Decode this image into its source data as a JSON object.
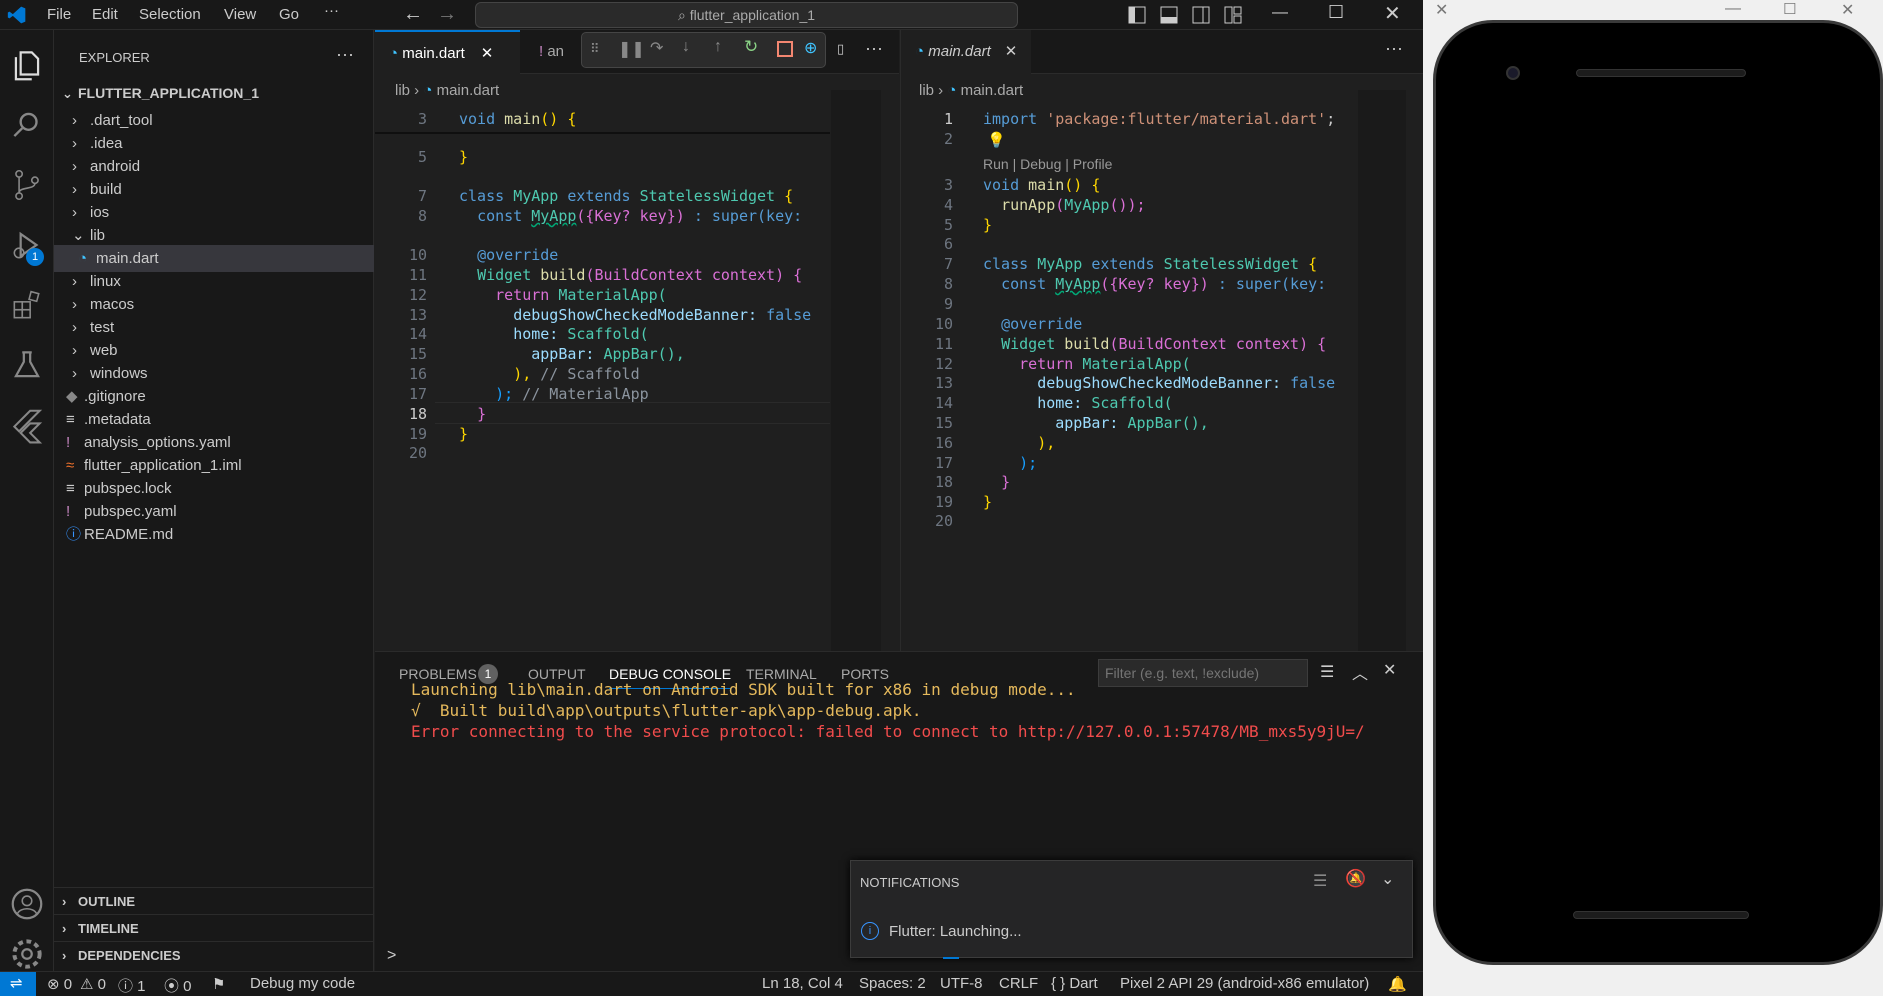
{
  "titlebar": {
    "menus": [
      "File",
      "Edit",
      "Selection",
      "View",
      "Go",
      "···"
    ],
    "search": "flutter_application_1"
  },
  "sidebar": {
    "header": "EXPLORER",
    "project": "FLUTTER_APPLICATION_1",
    "items": [
      {
        "label": ".dart_tool",
        "type": "folder",
        "depth": 1
      },
      {
        "label": ".idea",
        "type": "folder",
        "depth": 1
      },
      {
        "label": "android",
        "type": "folder",
        "depth": 1
      },
      {
        "label": "build",
        "type": "folder",
        "depth": 1
      },
      {
        "label": "ios",
        "type": "folder",
        "depth": 1
      },
      {
        "label": "lib",
        "type": "folder-open",
        "depth": 1
      },
      {
        "label": "main.dart",
        "type": "dart",
        "depth": 2
      },
      {
        "label": "linux",
        "type": "folder",
        "depth": 1
      },
      {
        "label": "macos",
        "type": "folder",
        "depth": 1
      },
      {
        "label": "test",
        "type": "folder",
        "depth": 1
      },
      {
        "label": "web",
        "type": "folder",
        "depth": 1
      },
      {
        "label": "windows",
        "type": "folder",
        "depth": 1
      },
      {
        "label": ".gitignore",
        "type": "git",
        "depth": 1
      },
      {
        "label": ".metadata",
        "type": "lines",
        "depth": 1
      },
      {
        "label": "analysis_options.yaml",
        "type": "yaml",
        "depth": 1
      },
      {
        "label": "flutter_application_1.iml",
        "type": "rss",
        "depth": 1
      },
      {
        "label": "pubspec.lock",
        "type": "lines",
        "depth": 1
      },
      {
        "label": "pubspec.yaml",
        "type": "yaml",
        "depth": 1
      },
      {
        "label": "README.md",
        "type": "info",
        "depth": 1
      }
    ],
    "sections": [
      "OUTLINE",
      "TIMELINE",
      "DEPENDENCIES"
    ]
  },
  "activity": {
    "debug_badge": "1"
  },
  "editor_left": {
    "tab1": "main.dart",
    "tab2": "an",
    "breadcrumb": [
      "lib",
      "main.dart"
    ],
    "lines": [
      "3",
      "5",
      "7",
      "8",
      "10",
      "11",
      "12",
      "13",
      "14",
      "15",
      "16",
      "17",
      "18",
      "19",
      "20"
    ]
  },
  "editor_right": {
    "tab": "main.dart",
    "breadcrumb": [
      "lib",
      "main.dart"
    ],
    "codelens": "Run | Debug | Profile",
    "lines": [
      "1",
      "2",
      "3",
      "4",
      "5",
      "6",
      "7",
      "8",
      "9",
      "10",
      "11",
      "12",
      "13",
      "14",
      "15",
      "16",
      "17",
      "18",
      "19",
      "20"
    ]
  },
  "code": {
    "import_kw": "import",
    "import_str": "'package:flutter/material.dart'",
    "semi": ";",
    "void": "void",
    "main": "main",
    "parens_open": "() {",
    "runapp": "runApp",
    "myapp_call": "MyApp",
    "runapp_tail": "());",
    "close_brace": "}",
    "class": "class",
    "myapp": "MyApp",
    "extends": "extends",
    "stateless": "StatelessWidget",
    "brace": "{",
    "const": "const",
    "ctor_args": "({Key? key})",
    "super": ": super(key:",
    "override": "@override",
    "widget": "Widget",
    "build": "build",
    "build_args": "(BuildContext context) {",
    "return": "return",
    "materialapp": "MaterialApp(",
    "debug_banner": "debugShowCheckedModeBanner:",
    "false": "false",
    "home": "home:",
    "scaffold": "Scaffold(",
    "appbar_key": "appBar:",
    "appbar_val": "AppBar(),",
    "close_paren": "),",
    "scaffold_comment": "// Scaffold",
    "close_semi": ");",
    "material_comment": "// MaterialApp",
    "runapp_line_partial": "runApp(MyApp());"
  },
  "panel": {
    "tabs": [
      "PROBLEMS",
      "OUTPUT",
      "DEBUG CONSOLE",
      "TERMINAL",
      "PORTS"
    ],
    "problems_count": "1",
    "filter_placeholder": "Filter (e.g. text, !exclude)",
    "console": [
      {
        "text": "Launching lib\\main.dart on Android SDK built for x86 in debug mode...",
        "color": "#e5b95c"
      },
      {
        "text": "√  Built build\\app\\outputs\\flutter-apk\\app-debug.apk.",
        "color": "#e5b95c"
      },
      {
        "text": "Error connecting to the service protocol: failed to connect to http://127.0.0.1:57478/MB_mxs5y9jU=/",
        "color": "#f14c4c"
      }
    ],
    "prompt": ">"
  },
  "notifications": {
    "title": "NOTIFICATIONS",
    "message": "Flutter: Launching..."
  },
  "status": {
    "errors": "0",
    "warnings": "0",
    "info": "1",
    "ports": "0",
    "debug": "Debug my code",
    "position": "Ln 18, Col 4",
    "spaces": "Spaces: 2",
    "encoding": "UTF-8",
    "eol": "CRLF",
    "lang": "{ } Dart",
    "device": "Pixel 2 API 29 (android-x86 emulator)"
  }
}
